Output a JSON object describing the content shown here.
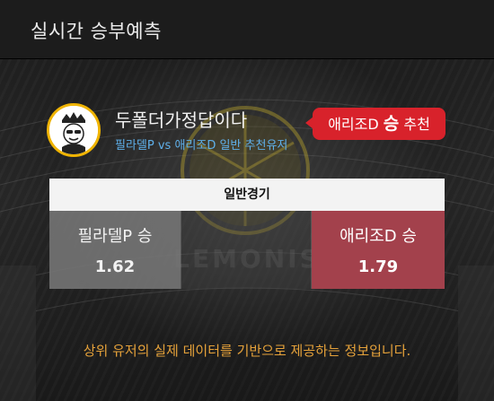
{
  "header": {
    "title": "실시간 승부예측"
  },
  "user": {
    "name": "두폴더가정답이다",
    "subline": "필라델P vs 애리조D 일반 추천유저"
  },
  "recommendation": {
    "team": "애리조D",
    "result": "승",
    "suffix": "추천"
  },
  "game": {
    "type_label": "일반경기",
    "home": {
      "label": "필라델P 승",
      "odds": "1.62"
    },
    "away": {
      "label": "애리조D 승",
      "odds": "1.79",
      "recommended": true
    }
  },
  "watermark": {
    "text": "LEMONIS"
  },
  "footer": {
    "note": "상위 유저의 실제 데이터를 기반으로 제공하는 정보입니다."
  },
  "colors": {
    "badge": "#d8222b",
    "recommended_pick": "#a3414c",
    "subline": "#5fb0ea",
    "footer_note": "#e6a23a",
    "avatar_ring": "#f0b400"
  }
}
